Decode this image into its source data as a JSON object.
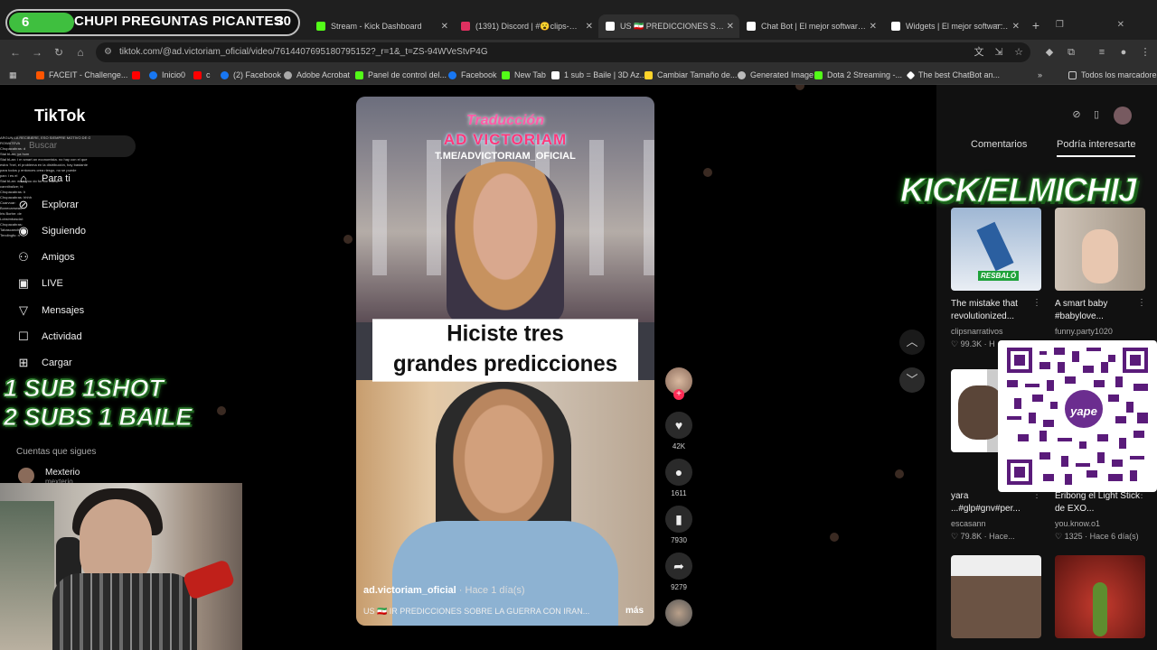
{
  "overlay_banner": {
    "number": "6",
    "text": "CHUPI PREGUNTAS PICANTES",
    "count": "30"
  },
  "tabs": [
    {
      "title": "Stream - Kick Dashboard",
      "color": "#53fc18"
    },
    {
      "title": "(1391) Discord | #😮clips-mem",
      "color": "#e03060"
    },
    {
      "title": "US 🇮🇷 PREDICCIONES SOBRE L",
      "color": "#ffffff",
      "active": true
    },
    {
      "title": "Chat Bot | El mejor software pa",
      "color": "#ffffff"
    },
    {
      "title": "Widgets | El mejor software pa",
      "color": "#ffffff"
    }
  ],
  "url": "tiktok.com/@ad.victoriam_oficial/video/7614407695180795152?_r=1&_t=ZS-94WVeStvP4G",
  "bookmarks": [
    {
      "label": "FACEIT - Challenge...",
      "color": "#ff5500"
    },
    {
      "label": "",
      "color": "#ff0000"
    },
    {
      "label": "Inicio0",
      "color": "#1877f2"
    },
    {
      "label": "c",
      "color": "#ff0000"
    },
    {
      "label": "(2) Facebook",
      "color": "#1877f2"
    },
    {
      "label": "Adobe Acrobat",
      "color": "#aaaaaa"
    },
    {
      "label": "Panel de control del...",
      "color": "#53fc18"
    },
    {
      "label": "Facebook",
      "color": "#1877f2"
    },
    {
      "label": "New Tab",
      "color": "#53fc18"
    },
    {
      "label": "1 sub = Baile | 3D Az...",
      "color": "#ffffff"
    },
    {
      "label": "Cambiar Tamaño de...",
      "color": "#ffd42a"
    },
    {
      "label": "Generated Image",
      "color": "#bbbbbb"
    },
    {
      "label": "Dota 2 Streaming -...",
      "color": "#53fc18"
    },
    {
      "label": "The best ChatBot an...",
      "color": "#ffffff"
    }
  ],
  "bookmarks_all": "Todos los marcadores",
  "logo": "TikTok",
  "search_placeholder": "Buscar",
  "nav": [
    {
      "label": "Para ti",
      "icon": "home-icon"
    },
    {
      "label": "Explorar",
      "icon": "compass-icon"
    },
    {
      "label": "Siguiendo",
      "icon": "following-icon"
    },
    {
      "label": "Amigos",
      "icon": "friends-icon"
    },
    {
      "label": "LIVE",
      "icon": "live-icon"
    },
    {
      "label": "Mensajes",
      "icon": "messages-icon"
    },
    {
      "label": "Actividad",
      "icon": "activity-icon"
    },
    {
      "label": "Cargar",
      "icon": "upload-icon"
    }
  ],
  "subs_overlay": [
    "1 SUB  1SHOT",
    "2 SUBS 1 BAILE"
  ],
  "following_header": "Cuentas que sigues",
  "following": [
    {
      "name": "Mexterio",
      "sub": "mexterio"
    }
  ],
  "video": {
    "watermark_top": "Traducción",
    "watermark_name": "AD VICTORIAM",
    "watermark_url": "T.ME/ADVICTORIAM_OFICIAL",
    "caption_line1": "Hiciste tres",
    "caption_line2": "grandes predicciones",
    "author": "ad.victoriam_oficial",
    "time": "· Hace 1 día(s)",
    "description": "US 🇮🇷 IR PREDICCIONES SOBRE LA GUERRA CON IRAN...",
    "more": "más"
  },
  "actions": {
    "likes": "42K",
    "comments": "1611",
    "saves": "7930",
    "shares": "9279"
  },
  "right_panel": {
    "tab1": "Comentarios",
    "tab2": "Podría interesarte",
    "kick": "KICK/ELMICHIJ",
    "items": [
      {
        "title": "The mistake that revolutionized...",
        "author": "clipsnarrativos",
        "likes": "♡ 99.3K · H",
        "thumb_label": "RESBALÓ"
      },
      {
        "title": "A smart baby #babylove...",
        "author": "funny.party1020",
        "likes": ""
      },
      {
        "title": "yara ...#glp#gnv#per...",
        "author": "escasann",
        "likes": "♡ 79.8K · Hace..."
      },
      {
        "title": "Eribong el Light Stick de EXO...",
        "author": "you.know.o1",
        "likes": "♡ 1325 · Hace 6 día(s)"
      }
    ]
  },
  "qr_brand": "yape",
  "chat_lines": [
    "ARGUN LA RECIBIERE, ESO SIEMPRE MOTIVO DE GRA",
    "ROWATEVA",
    "Chupacabras: d",
    "Stal bLan: ya hum",
    "Stal bLan: i m smart an economista. no hay con el que",
    "estra ?nel, el problema en la distribución, hay bastante",
    "para todos y entonces crea riesgo, no se puede",
    "pan: i es el",
    "Stal bLan: what you do for the follow",
    "cannibalize; hi",
    "Chupacabras: h",
    "Chupacabras: hhhh",
    "Coarvuar:",
    "Bonecamwas:",
    "Iris Borbe: de",
    "Lobsimbasdal:",
    "Chupacabras:",
    "Tabascanchiq:",
    "Tendingfu: n"
  ]
}
